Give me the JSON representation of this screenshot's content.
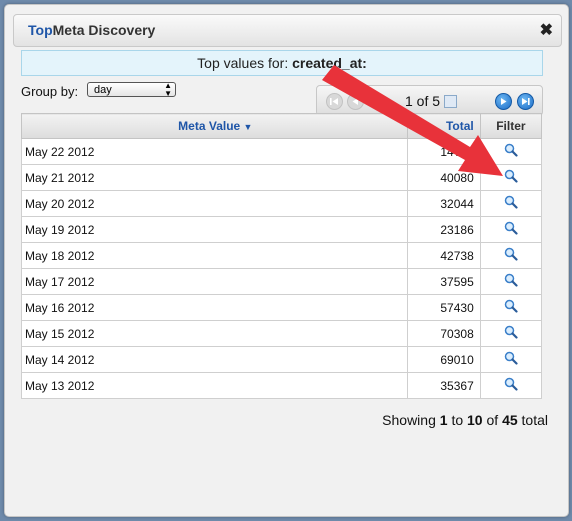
{
  "dialog": {
    "title_brand": "Top",
    "title_rest": "Meta Discovery",
    "close_label": "✖"
  },
  "banner": {
    "prefix": "Top values for:",
    "field": "created_at:"
  },
  "groupby": {
    "label": "Group by:",
    "selected": "day"
  },
  "pager": {
    "label": "1 of 5"
  },
  "table": {
    "headers": {
      "meta_value": "Meta Value",
      "sort_indicator": "▼",
      "total": "Total",
      "filter": "Filter"
    },
    "rows": [
      {
        "date": "May 22 2012",
        "total": "14???"
      },
      {
        "date": "May 21 2012",
        "total": "40080"
      },
      {
        "date": "May 20 2012",
        "total": "32044"
      },
      {
        "date": "May 19 2012",
        "total": "23186"
      },
      {
        "date": "May 18 2012",
        "total": "42738"
      },
      {
        "date": "May 17 2012",
        "total": "37595"
      },
      {
        "date": "May 16 2012",
        "total": "57430"
      },
      {
        "date": "May 15 2012",
        "total": "70308"
      },
      {
        "date": "May 14 2012",
        "total": "69010"
      },
      {
        "date": "May 13 2012",
        "total": "35367"
      }
    ]
  },
  "footer": {
    "showing": "Showing",
    "from": "1",
    "to_word": "to",
    "to": "10",
    "of_word": "of",
    "total": "45",
    "total_word": "total"
  },
  "colors": {
    "accent": "#1f56a8",
    "annotation_arrow": "#e8323a"
  },
  "icons": {
    "filter": "magnifier-icon"
  }
}
